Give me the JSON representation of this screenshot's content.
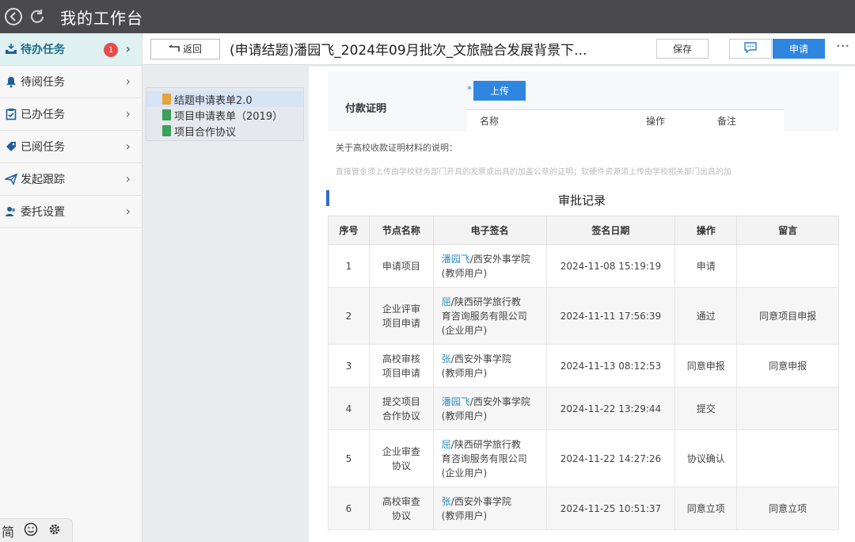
{
  "window": {
    "title": "我的工作台"
  },
  "sidebar": {
    "items": [
      {
        "label": "待办任务",
        "icon": "inbox-icon",
        "badge": "1"
      },
      {
        "label": "待阅任务",
        "icon": "bell-icon"
      },
      {
        "label": "已办任务",
        "icon": "clipboard-check-icon"
      },
      {
        "label": "已阅任务",
        "icon": "tag-icon"
      },
      {
        "label": "发起跟踪",
        "icon": "paper-plane-icon"
      },
      {
        "label": "委托设置",
        "icon": "user-group-icon"
      }
    ],
    "bottom": {
      "simplified_label": "简"
    }
  },
  "topbar": {
    "back_label": "返回",
    "title": "(申请结题)潘园飞_2024年09月批次_文旅融合发展背景下...",
    "save_label": "保存",
    "apply_label": "申请",
    "more_label": "···"
  },
  "tree": {
    "items": [
      {
        "label": "结题申请表单2.0",
        "color": "#e8a33a"
      },
      {
        "label": "项目申请表单（2019）",
        "color": "#3aa05a"
      },
      {
        "label": "项目合作协议",
        "color": "#3aa05a"
      }
    ]
  },
  "payment": {
    "label": "付款证明",
    "required_mark": "*",
    "upload_label": "上传",
    "columns": [
      "名称",
      "操作",
      "备注"
    ]
  },
  "note": {
    "title": "关于高校收款证明材料的说明：",
    "body": "直接管金须上传由学校财务部门开具的发票或出具的加盖公章的证明；软硬件资源须上传由学校相关部门出具的加"
  },
  "approval": {
    "title": "审批记录",
    "columns": [
      "序号",
      "节点名称",
      "电子签名",
      "签名日期",
      "操作",
      "留言"
    ],
    "rows": [
      {
        "seq": "1",
        "node": [
          "申请项目"
        ],
        "sig_name": "潘园飞",
        "sig_rest": "/西安外事学院",
        "sig_lines": [
          "(教师用户)"
        ],
        "date": "2024-11-08 15:19:19",
        "op": "申请",
        "msg": ""
      },
      {
        "seq": "2",
        "node": [
          "企业评审",
          "项目申请"
        ],
        "sig_name": "屈",
        "sig_rest": "/陕西研学旅行教",
        "sig_lines": [
          "育咨询服务有限公司",
          "(企业用户)"
        ],
        "date": "2024-11-11 17:56:39",
        "op": "通过",
        "msg": "同意项目申报"
      },
      {
        "seq": "3",
        "node": [
          "高校审核",
          "项目申请"
        ],
        "sig_name": "张",
        "sig_rest": "/西安外事学院",
        "sig_lines": [
          "(教师用户)"
        ],
        "date": "2024-11-13 08:12:53",
        "op": "同意申报",
        "msg": "同意申报"
      },
      {
        "seq": "4",
        "node": [
          "提交项目",
          "合作协议"
        ],
        "sig_name": "潘园飞",
        "sig_rest": "/西安外事学院",
        "sig_lines": [
          "(教师用户)"
        ],
        "date": "2024-11-22 13:29:44",
        "op": "提交",
        "msg": ""
      },
      {
        "seq": "5",
        "node": [
          "企业审查",
          "协议"
        ],
        "sig_name": "屈",
        "sig_rest": "/陕西研学旅行教",
        "sig_lines": [
          "育咨询服务有限公司",
          "(企业用户)"
        ],
        "date": "2024-11-22 14:27:26",
        "op": "协议确认",
        "msg": ""
      },
      {
        "seq": "6",
        "node": [
          "高校审查",
          "协议"
        ],
        "sig_name": "张",
        "sig_rest": "/西安外事学院",
        "sig_lines": [
          "(教师用户)"
        ],
        "date": "2024-11-25 10:51:37",
        "op": "同意立项",
        "msg": "同意立项"
      }
    ]
  }
}
